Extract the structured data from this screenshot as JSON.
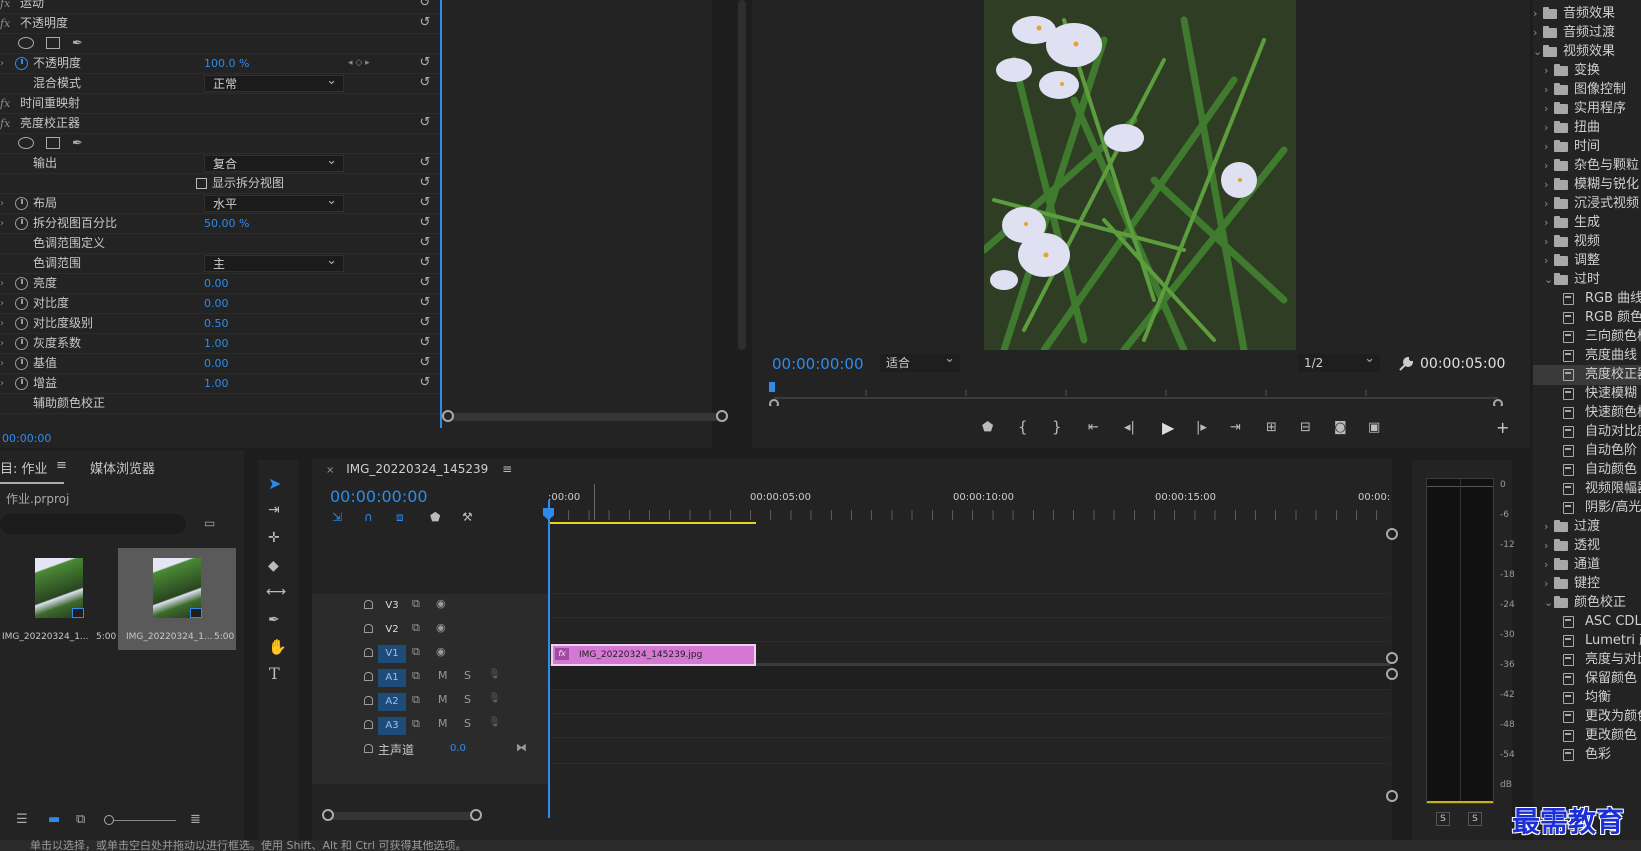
{
  "effect_controls": {
    "rows": [
      {
        "kind": "fx-header",
        "label": "运动"
      },
      {
        "kind": "fx-header",
        "label": "不透明度"
      },
      {
        "kind": "shapes"
      },
      {
        "kind": "param",
        "label": "不透明度",
        "value": "100.0 %",
        "stopwatch_on": true,
        "keyframes": true
      },
      {
        "kind": "dropdown",
        "label": "混合模式",
        "value": "正常"
      },
      {
        "kind": "fx-header",
        "label": "时间重映射",
        "no_reset": true
      },
      {
        "kind": "fx-header",
        "label": "亮度校正器"
      },
      {
        "kind": "shapes"
      },
      {
        "kind": "dropdown",
        "label": "输出",
        "value": "复合"
      },
      {
        "kind": "checkbox",
        "label": "显示拆分视图"
      },
      {
        "kind": "dropdown-sw",
        "label": "布局",
        "value": "水平"
      },
      {
        "kind": "param",
        "label": "拆分视图百分比",
        "value": "50.00 %"
      },
      {
        "kind": "text",
        "label": "色调范围定义"
      },
      {
        "kind": "dropdown",
        "label": "色调范围",
        "value": "主"
      },
      {
        "kind": "param",
        "label": "亮度",
        "value": "0.00"
      },
      {
        "kind": "param",
        "label": "对比度",
        "value": "0.00"
      },
      {
        "kind": "param",
        "label": "对比度级别",
        "value": "0.50"
      },
      {
        "kind": "param",
        "label": "灰度系数",
        "value": "1.00"
      },
      {
        "kind": "param",
        "label": "基值",
        "value": "0.00"
      },
      {
        "kind": "param",
        "label": "增益",
        "value": "1.00"
      },
      {
        "kind": "text",
        "label": "辅助颜色校正",
        "no_reset": true
      }
    ],
    "timecode": "00:00:00"
  },
  "program": {
    "timecode": "00:00:00:00",
    "fit": "适合",
    "resolution": "1/2",
    "duration": "00:00:05:00"
  },
  "effects_tree": [
    {
      "level": 0,
      "type": "folder",
      "open": false,
      "label": "音频效果"
    },
    {
      "level": 0,
      "type": "folder",
      "open": false,
      "label": "音频过渡"
    },
    {
      "level": 0,
      "type": "folder",
      "open": true,
      "label": "视频效果"
    },
    {
      "level": 1,
      "type": "folder",
      "open": false,
      "label": "变换"
    },
    {
      "level": 1,
      "type": "folder",
      "open": false,
      "label": "图像控制"
    },
    {
      "level": 1,
      "type": "folder",
      "open": false,
      "label": "实用程序"
    },
    {
      "level": 1,
      "type": "folder",
      "open": false,
      "label": "扭曲"
    },
    {
      "level": 1,
      "type": "folder",
      "open": false,
      "label": "时间"
    },
    {
      "level": 1,
      "type": "folder",
      "open": false,
      "label": "杂色与颗粒"
    },
    {
      "level": 1,
      "type": "folder",
      "open": false,
      "label": "模糊与锐化"
    },
    {
      "level": 1,
      "type": "folder",
      "open": false,
      "label": "沉浸式视频"
    },
    {
      "level": 1,
      "type": "folder",
      "open": false,
      "label": "生成"
    },
    {
      "level": 1,
      "type": "folder",
      "open": false,
      "label": "视频"
    },
    {
      "level": 1,
      "type": "folder",
      "open": false,
      "label": "调整"
    },
    {
      "level": 1,
      "type": "folder",
      "open": true,
      "label": "过时"
    },
    {
      "level": 2,
      "type": "fx",
      "label": "RGB 曲线"
    },
    {
      "level": 2,
      "type": "fx",
      "label": "RGB 颜色校正器"
    },
    {
      "level": 2,
      "type": "fx",
      "label": "三向颜色校正器"
    },
    {
      "level": 2,
      "type": "fx",
      "label": "亮度曲线"
    },
    {
      "level": 2,
      "type": "fx",
      "label": "亮度校正器",
      "selected": true
    },
    {
      "level": 2,
      "type": "fx",
      "label": "快速模糊"
    },
    {
      "level": 2,
      "type": "fx",
      "label": "快速颜色校正器"
    },
    {
      "level": 2,
      "type": "fx",
      "label": "自动对比度"
    },
    {
      "level": 2,
      "type": "fx",
      "label": "自动色阶"
    },
    {
      "level": 2,
      "type": "fx",
      "label": "自动颜色"
    },
    {
      "level": 2,
      "type": "fx",
      "label": "视频限幅器"
    },
    {
      "level": 2,
      "type": "fx",
      "label": "阴影/高光"
    },
    {
      "level": 1,
      "type": "folder",
      "open": false,
      "label": "过渡"
    },
    {
      "level": 1,
      "type": "folder",
      "open": false,
      "label": "透视"
    },
    {
      "level": 1,
      "type": "folder",
      "open": false,
      "label": "通道"
    },
    {
      "level": 1,
      "type": "folder",
      "open": false,
      "label": "键控"
    },
    {
      "level": 1,
      "type": "folder",
      "open": true,
      "label": "颜色校正"
    },
    {
      "level": 2,
      "type": "fx",
      "label": "ASC CDL"
    },
    {
      "level": 2,
      "type": "fx",
      "label": "Lumetri 颜色"
    },
    {
      "level": 2,
      "type": "fx",
      "label": "亮度与对比度"
    },
    {
      "level": 2,
      "type": "fx",
      "label": "保留颜色"
    },
    {
      "level": 2,
      "type": "fx",
      "label": "均衡"
    },
    {
      "level": 2,
      "type": "fx",
      "label": "更改为颜色"
    },
    {
      "level": 2,
      "type": "fx",
      "label": "更改颜色"
    },
    {
      "level": 2,
      "type": "fx",
      "label": "色彩"
    }
  ],
  "project": {
    "tab_project": "目: 作业",
    "tab_media": "媒体浏览器",
    "file_name": "作业.prproj",
    "items": [
      {
        "name": "IMG_20220324_1...",
        "duration": "5:00"
      },
      {
        "name": "IMG_20220324_1...",
        "duration": "5:00",
        "selected": true
      }
    ]
  },
  "timeline": {
    "sequence_name": "IMG_20220324_145239",
    "timecode": "00:00:00:00",
    "ruler_labels": [
      ":00:00",
      "00:00:05:00",
      "00:00:10:00",
      "00:00:15:00",
      "00:00:"
    ],
    "video_tracks": [
      "V3",
      "V2",
      "V1"
    ],
    "audio_tracks": [
      "A1",
      "A2",
      "A3"
    ],
    "master_label": "主声道",
    "master_value": "0.0",
    "mute": "M",
    "solo": "S",
    "clip_name": "IMG_20220324_145239.jpg",
    "clip_fx": "fx"
  },
  "meter": {
    "db_labels": [
      "0",
      "-6",
      "-12",
      "-18",
      "-24",
      "-30",
      "-36",
      "-42",
      "-48",
      "-54",
      "dB"
    ],
    "solo_left": "S",
    "solo_right": "S"
  },
  "status_text": "单击以选择，或单击空白处并拖动以进行框选。使用 Shift、Alt 和 Ctrl 可获得其他选项。",
  "watermark": "最需教育",
  "colors": {
    "accent": "#2d8ceb",
    "clip": "#d478d4",
    "work_area": "#e7d11c",
    "panel": "#232323"
  }
}
